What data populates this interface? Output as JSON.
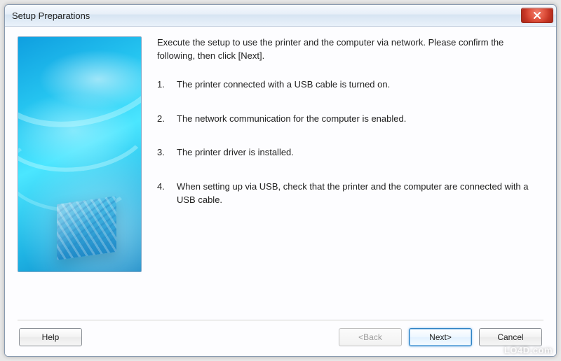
{
  "window": {
    "title": "Setup Preparations",
    "close_icon": "close-icon"
  },
  "content": {
    "intro": "Execute the setup to use the printer and the computer via network. Please confirm the following, then click [Next].",
    "steps": [
      {
        "n": "1.",
        "text": "The printer connected with a USB cable is turned on."
      },
      {
        "n": "2.",
        "text": "The network communication for the computer is enabled."
      },
      {
        "n": "3.",
        "text": "The printer driver is installed."
      },
      {
        "n": "4.",
        "text": "When setting up via USB, check that the printer and the computer are connected with a USB cable."
      }
    ]
  },
  "buttons": {
    "help": "Help",
    "back": "<Back",
    "next": "Next>",
    "cancel": "Cancel"
  },
  "watermark": "LO4D.com"
}
